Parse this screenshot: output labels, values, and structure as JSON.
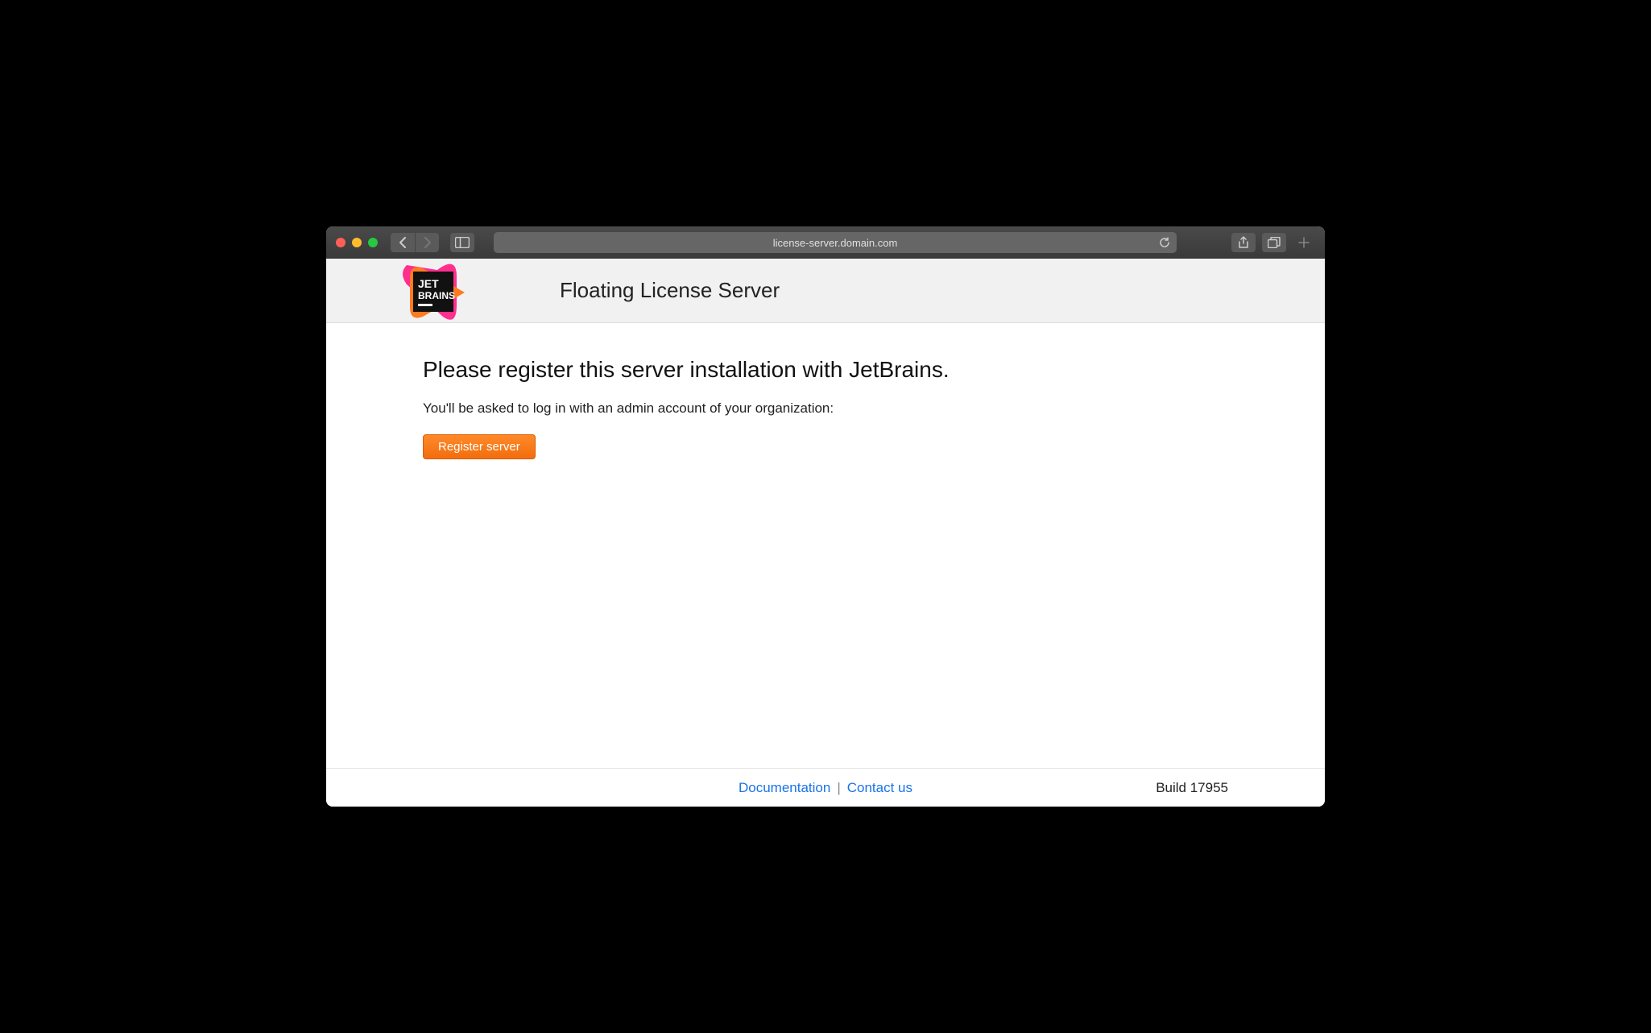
{
  "browser": {
    "url": "license-server.domain.com"
  },
  "header": {
    "title": "Floating License Server",
    "logo_text_1": "JET",
    "logo_text_2": "BRAINS"
  },
  "main": {
    "heading": "Please register this server installation with JetBrains.",
    "subtext": "You'll be asked to log in with an admin account of your organization:",
    "register_label": "Register server"
  },
  "footer": {
    "documentation_label": "Documentation",
    "contact_label": "Contact us",
    "separator": "|",
    "build_label": "Build 17955"
  }
}
